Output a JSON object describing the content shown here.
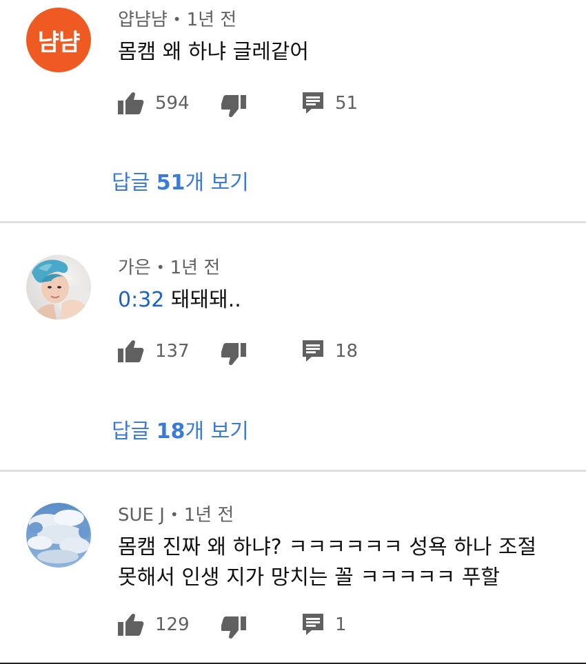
{
  "comments": [
    {
      "author": "얍냠냠",
      "separator": "•",
      "time": "1년 전",
      "avatar_text": "냠냠",
      "avatar_color": "#ef5a22",
      "text_line1": "몸캠 왜 하냐 글레같어",
      "likes": "594",
      "replies_count": "51",
      "view_replies_prefix": "답글 ",
      "view_replies_count": "51",
      "view_replies_suffix": "개 보기"
    },
    {
      "author": "가은",
      "separator": "•",
      "time": "1년 전",
      "timestamp_link": "0:32",
      "text_rest": " 돼돼돼..",
      "likes": "137",
      "replies_count": "18",
      "view_replies_prefix": "답글 ",
      "view_replies_count": "18",
      "view_replies_suffix": "개 보기"
    },
    {
      "author": "SUE J",
      "separator": "•",
      "time": "1년 전",
      "text_line1": "몸캠 진짜 왜 하냐? ㅋㅋㅋㅋㅋㅋ 성욕 하나 조절",
      "text_line2": "못해서 인생 지가 망치는 꼴 ㅋㅋㅋㅋㅋ 푸할",
      "likes": "129",
      "replies_count": "1"
    }
  ],
  "icons": {
    "like": "thumbs-up-icon",
    "dislike": "thumbs-down-icon",
    "reply": "comment-icon"
  },
  "colors": {
    "link_blue": "#3a7bd5",
    "timestamp_blue": "#1a62c6",
    "meta_gray": "#606060"
  }
}
